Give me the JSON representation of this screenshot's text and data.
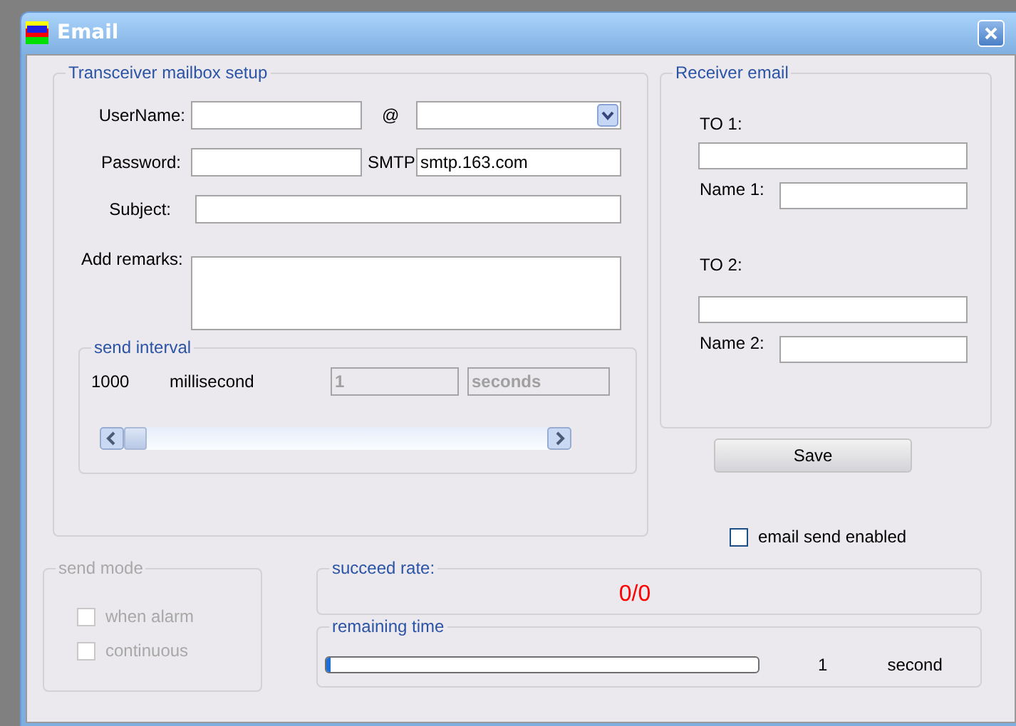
{
  "window": {
    "title": "Email"
  },
  "mailbox_setup": {
    "title": "Transceiver mailbox setup",
    "username": {
      "label": "UserName:"
    },
    "at_label": "@",
    "domain": {
      "kind": "combo"
    },
    "password": {
      "label": "Password:"
    },
    "smtp": {
      "label": "SMTP",
      "value": "smtp.163.com"
    },
    "subject": {
      "label": "Subject:"
    },
    "remarks": {
      "label": "Add remarks:"
    },
    "send_interval": {
      "title": "send interval",
      "value": "1000",
      "unit": "millisecond",
      "count_field": {
        "value": "1",
        "disabled": true
      },
      "unit_combo": {
        "value": "seconds",
        "disabled": true
      },
      "slider": {
        "level": 0
      }
    }
  },
  "receiver_email": {
    "title": "Receiver email",
    "recipients": [
      {
        "to_label": "TO 1:",
        "name_label": "Name 1:"
      },
      {
        "to_label": "TO 2:",
        "name_label": "Name 2:"
      }
    ]
  },
  "save_button": "Save",
  "email_send_enabled": {
    "label": "email send enabled",
    "checked": false
  },
  "send_mode": {
    "title": "send mode",
    "disabled": true,
    "options": [
      {
        "label": "when alarm",
        "checked": false
      },
      {
        "label": "continuous",
        "checked": false
      }
    ]
  },
  "succeed_rate": {
    "title": "succeed rate:",
    "value": "0/0"
  },
  "remaining_time": {
    "title": "remaining time",
    "level": 0.01,
    "value": "1",
    "unit": "second"
  }
}
